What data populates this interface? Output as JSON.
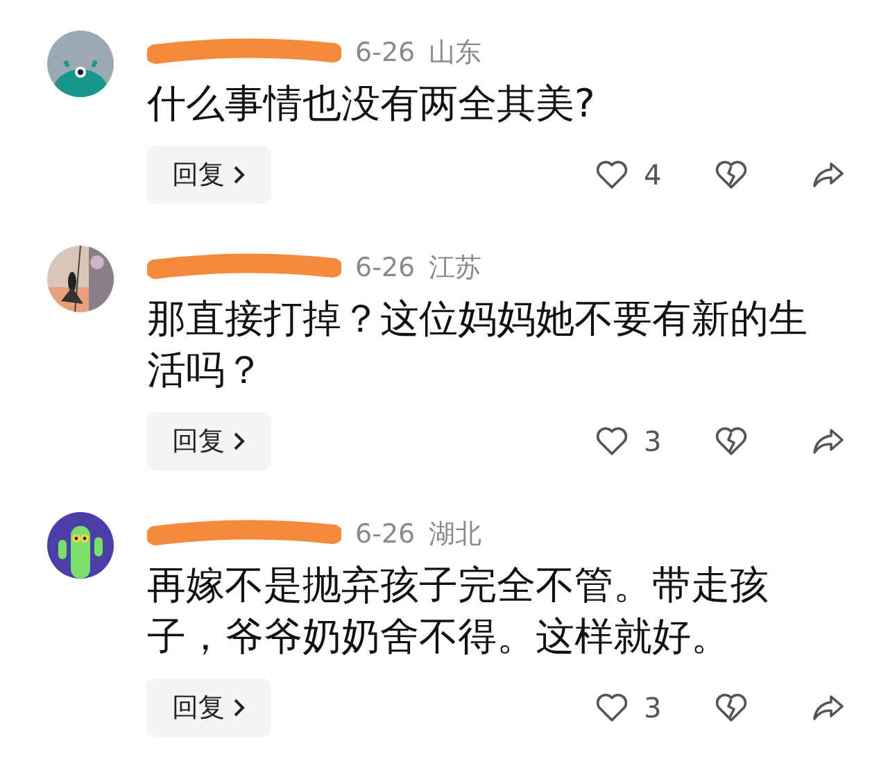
{
  "comments": [
    {
      "kind": "creature",
      "date": "6-26",
      "location": "山东",
      "text": "什么事情也没有两全其美?",
      "reply": "回复",
      "likes": "4"
    },
    {
      "kind": "picture",
      "date": "6-26",
      "location": "江苏",
      "text": "那直接打掉？这位妈妈她不要有新的生活吗？",
      "reply": "回复",
      "likes": "3"
    },
    {
      "kind": "cactus",
      "date": "6-26",
      "location": "湖北",
      "text": "再嫁不是抛弃孩子完全不管。带走孩子，爷爷奶奶舍不得。这样就好。",
      "reply": "回复",
      "likes": "3"
    }
  ]
}
